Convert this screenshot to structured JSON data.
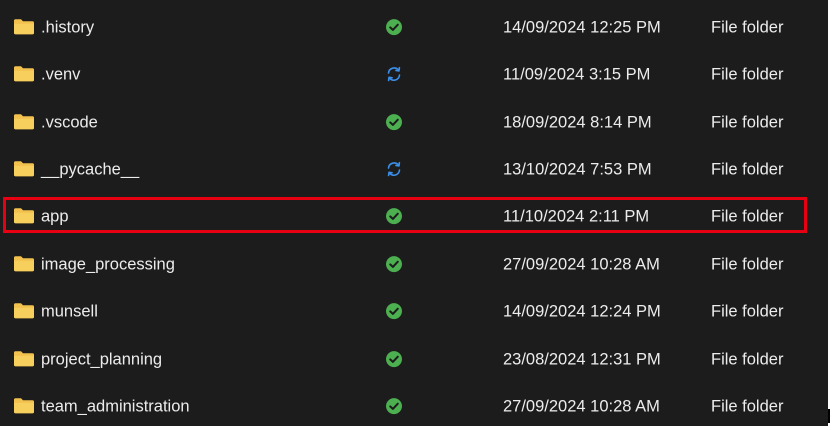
{
  "colors": {
    "background": "#1c1c1c",
    "text": "#ececec",
    "folder_icon": "#f2c14e",
    "synced_status": "#4caf50",
    "syncing_status": "#3b8ee8",
    "highlight_border": "#e60012"
  },
  "files": [
    {
      "name": ".history",
      "status": "synced",
      "modified": "14/09/2024 12:25 PM",
      "type": "File folder"
    },
    {
      "name": ".venv",
      "status": "syncing",
      "modified": "11/09/2024 3:15 PM",
      "type": "File folder"
    },
    {
      "name": ".vscode",
      "status": "synced",
      "modified": "18/09/2024 8:14 PM",
      "type": "File folder"
    },
    {
      "name": "__pycache__",
      "status": "syncing",
      "modified": "13/10/2024 7:53 PM",
      "type": "File folder"
    },
    {
      "name": "app",
      "status": "synced",
      "modified": "11/10/2024 2:11 PM",
      "type": "File folder",
      "highlighted": true
    },
    {
      "name": "image_processing",
      "status": "synced",
      "modified": "27/09/2024 10:28 AM",
      "type": "File folder"
    },
    {
      "name": "munsell",
      "status": "synced",
      "modified": "14/09/2024 12:24 PM",
      "type": "File folder"
    },
    {
      "name": "project_planning",
      "status": "synced",
      "modified": "23/08/2024 12:31 PM",
      "type": "File folder"
    },
    {
      "name": "team_administration",
      "status": "synced",
      "modified": "27/09/2024 10:28 AM",
      "type": "File folder"
    }
  ]
}
